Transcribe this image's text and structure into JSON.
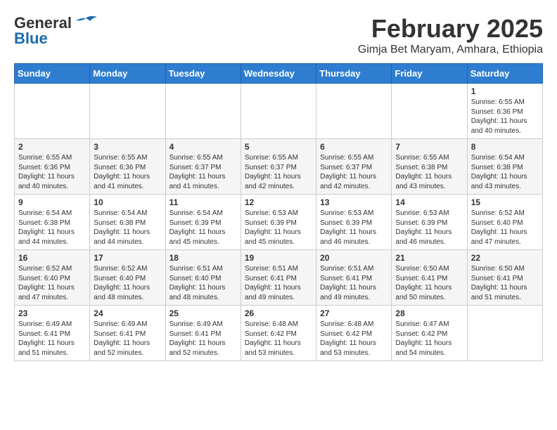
{
  "header": {
    "logo_general": "General",
    "logo_blue": "Blue",
    "month_title": "February 2025",
    "subtitle": "Gimja Bet Maryam, Amhara, Ethiopia"
  },
  "days_of_week": [
    "Sunday",
    "Monday",
    "Tuesday",
    "Wednesday",
    "Thursday",
    "Friday",
    "Saturday"
  ],
  "weeks": [
    [
      {
        "day": "",
        "info": ""
      },
      {
        "day": "",
        "info": ""
      },
      {
        "day": "",
        "info": ""
      },
      {
        "day": "",
        "info": ""
      },
      {
        "day": "",
        "info": ""
      },
      {
        "day": "",
        "info": ""
      },
      {
        "day": "1",
        "info": "Sunrise: 6:55 AM\nSunset: 6:36 PM\nDaylight: 11 hours\nand 40 minutes."
      }
    ],
    [
      {
        "day": "2",
        "info": "Sunrise: 6:55 AM\nSunset: 6:36 PM\nDaylight: 11 hours\nand 40 minutes."
      },
      {
        "day": "3",
        "info": "Sunrise: 6:55 AM\nSunset: 6:36 PM\nDaylight: 11 hours\nand 41 minutes."
      },
      {
        "day": "4",
        "info": "Sunrise: 6:55 AM\nSunset: 6:37 PM\nDaylight: 11 hours\nand 41 minutes."
      },
      {
        "day": "5",
        "info": "Sunrise: 6:55 AM\nSunset: 6:37 PM\nDaylight: 11 hours\nand 42 minutes."
      },
      {
        "day": "6",
        "info": "Sunrise: 6:55 AM\nSunset: 6:37 PM\nDaylight: 11 hours\nand 42 minutes."
      },
      {
        "day": "7",
        "info": "Sunrise: 6:55 AM\nSunset: 6:38 PM\nDaylight: 11 hours\nand 43 minutes."
      },
      {
        "day": "8",
        "info": "Sunrise: 6:54 AM\nSunset: 6:38 PM\nDaylight: 11 hours\nand 43 minutes."
      }
    ],
    [
      {
        "day": "9",
        "info": "Sunrise: 6:54 AM\nSunset: 6:38 PM\nDaylight: 11 hours\nand 44 minutes."
      },
      {
        "day": "10",
        "info": "Sunrise: 6:54 AM\nSunset: 6:38 PM\nDaylight: 11 hours\nand 44 minutes."
      },
      {
        "day": "11",
        "info": "Sunrise: 6:54 AM\nSunset: 6:39 PM\nDaylight: 11 hours\nand 45 minutes."
      },
      {
        "day": "12",
        "info": "Sunrise: 6:53 AM\nSunset: 6:39 PM\nDaylight: 11 hours\nand 45 minutes."
      },
      {
        "day": "13",
        "info": "Sunrise: 6:53 AM\nSunset: 6:39 PM\nDaylight: 11 hours\nand 46 minutes."
      },
      {
        "day": "14",
        "info": "Sunrise: 6:53 AM\nSunset: 6:39 PM\nDaylight: 11 hours\nand 46 minutes."
      },
      {
        "day": "15",
        "info": "Sunrise: 6:52 AM\nSunset: 6:40 PM\nDaylight: 11 hours\nand 47 minutes."
      }
    ],
    [
      {
        "day": "16",
        "info": "Sunrise: 6:52 AM\nSunset: 6:40 PM\nDaylight: 11 hours\nand 47 minutes."
      },
      {
        "day": "17",
        "info": "Sunrise: 6:52 AM\nSunset: 6:40 PM\nDaylight: 11 hours\nand 48 minutes."
      },
      {
        "day": "18",
        "info": "Sunrise: 6:51 AM\nSunset: 6:40 PM\nDaylight: 11 hours\nand 48 minutes."
      },
      {
        "day": "19",
        "info": "Sunrise: 6:51 AM\nSunset: 6:41 PM\nDaylight: 11 hours\nand 49 minutes."
      },
      {
        "day": "20",
        "info": "Sunrise: 6:51 AM\nSunset: 6:41 PM\nDaylight: 11 hours\nand 49 minutes."
      },
      {
        "day": "21",
        "info": "Sunrise: 6:50 AM\nSunset: 6:41 PM\nDaylight: 11 hours\nand 50 minutes."
      },
      {
        "day": "22",
        "info": "Sunrise: 6:50 AM\nSunset: 6:41 PM\nDaylight: 11 hours\nand 51 minutes."
      }
    ],
    [
      {
        "day": "23",
        "info": "Sunrise: 6:49 AM\nSunset: 6:41 PM\nDaylight: 11 hours\nand 51 minutes."
      },
      {
        "day": "24",
        "info": "Sunrise: 6:49 AM\nSunset: 6:41 PM\nDaylight: 11 hours\nand 52 minutes."
      },
      {
        "day": "25",
        "info": "Sunrise: 6:49 AM\nSunset: 6:41 PM\nDaylight: 11 hours\nand 52 minutes."
      },
      {
        "day": "26",
        "info": "Sunrise: 6:48 AM\nSunset: 6:42 PM\nDaylight: 11 hours\nand 53 minutes."
      },
      {
        "day": "27",
        "info": "Sunrise: 6:48 AM\nSunset: 6:42 PM\nDaylight: 11 hours\nand 53 minutes."
      },
      {
        "day": "28",
        "info": "Sunrise: 6:47 AM\nSunset: 6:42 PM\nDaylight: 11 hours\nand 54 minutes."
      },
      {
        "day": "",
        "info": ""
      }
    ]
  ]
}
